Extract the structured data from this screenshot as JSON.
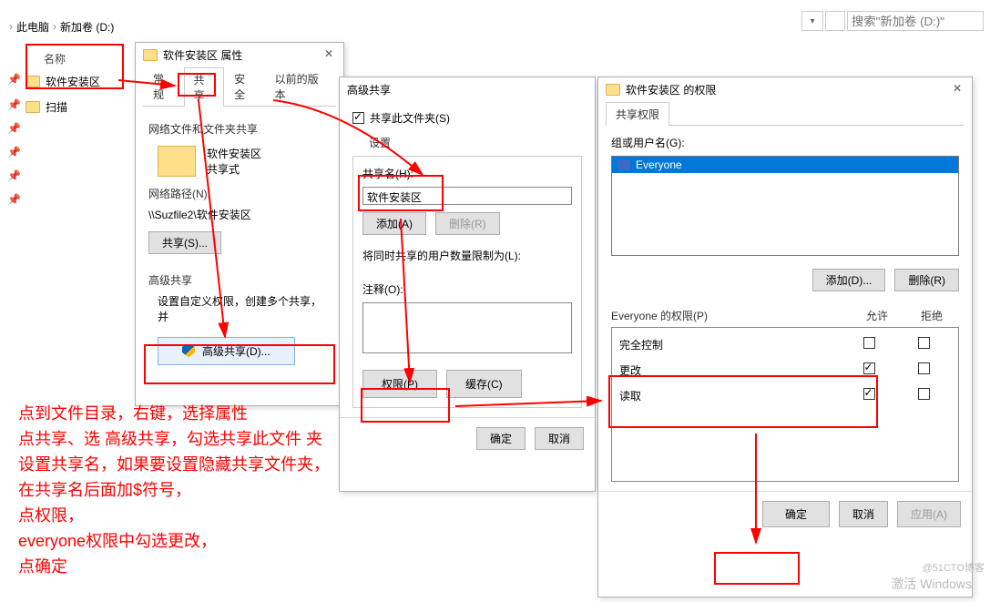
{
  "breadcrumb": {
    "part1": "此电脑",
    "part2": "新加卷 (D:)",
    "sep": "›"
  },
  "search": {
    "placeholder": "搜索\"新加卷 (D:)\""
  },
  "column_header": "名称",
  "folders": [
    {
      "name": "软件安装区"
    },
    {
      "name": "扫描"
    }
  ],
  "win1": {
    "title": "软件安装区 属性",
    "tabs": {
      "general": "常规",
      "share": "共享",
      "security": "安全",
      "prev": "以前的版本"
    },
    "section1_title": "网络文件和文件夹共享",
    "folder_name": "软件安装区",
    "share_state": "共享式",
    "netpath_label": "网络路径(N):",
    "netpath_value": "\\\\Suzfile2\\软件安装区",
    "share_btn": "共享(S)...",
    "adv_title": "高级共享",
    "adv_desc": "设置自定义权限，创建多个共享，并",
    "adv_btn": "高级共享(D)..."
  },
  "win2": {
    "title": "高级共享",
    "chk_label": "共享此文件夹(S)",
    "settings_label": "设置",
    "sharename_label": "共享名(H):",
    "sharename_value": "软件安装区",
    "add_btn": "添加(A)",
    "remove_btn": "删除(R)",
    "limit_label": "将同时共享的用户数量限制为(L):",
    "comment_label": "注释(O):",
    "perm_btn": "权限(P)",
    "cache_btn": "缓存(C)",
    "ok": "确定",
    "cancel": "取消"
  },
  "win3": {
    "title": "软件安装区 的权限",
    "tab": "共享权限",
    "groups_label": "组或用户名(G):",
    "user": "Everyone",
    "add_btn": "添加(D)...",
    "remove_btn": "删除(R)",
    "perm_for": "Everyone 的权限(P)",
    "allow": "允许",
    "deny": "拒绝",
    "perms": [
      {
        "name": "完全控制",
        "allow": false,
        "deny": false
      },
      {
        "name": "更改",
        "allow": true,
        "deny": false
      },
      {
        "name": "读取",
        "allow": true,
        "deny": false
      }
    ],
    "ok": "确定",
    "cancel": "取消",
    "apply": "应用(A)"
  },
  "annotation": {
    "l1": "点到文件目录，右键，选择属性",
    "l2": "点共享、选 高级共享，勾选共享此文件 夹",
    "l3": "设置共享名，如果要设置隐藏共享文件夹，",
    "l4": "在共享名后面加$符号，",
    "l5": "点权限，",
    "l6": "everyone权限中勾选更改，",
    "l7": "点确定"
  },
  "watermark": "激活 Windows",
  "watermark2": "@51CTO博客"
}
